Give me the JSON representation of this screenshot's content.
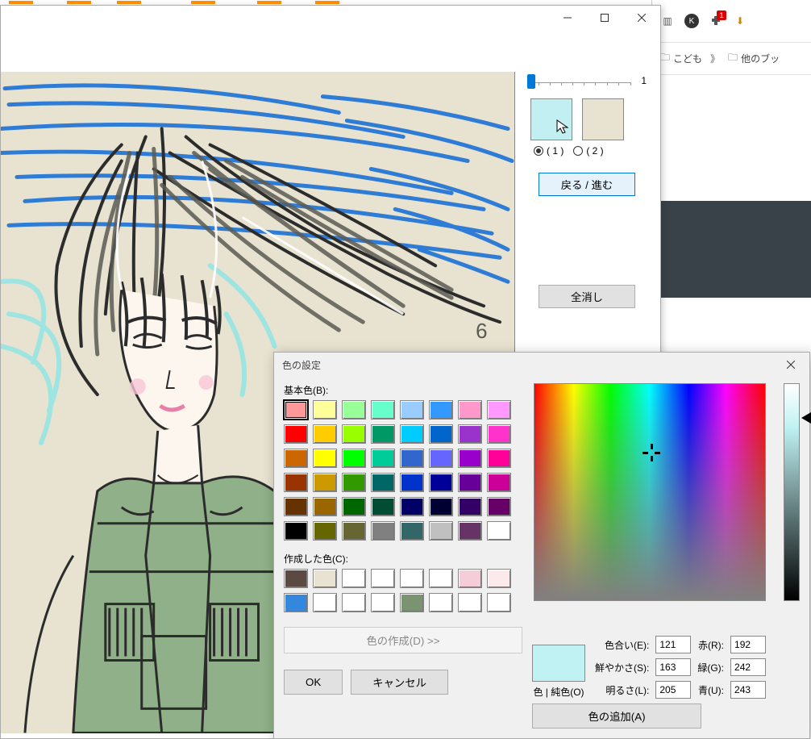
{
  "browser": {
    "bookmark1": "こども",
    "bookmark2": "他のブッ",
    "more": "》",
    "badge": "1"
  },
  "paint": {
    "slider_value": "1",
    "swatch1_color": "#c2f0f2",
    "swatch2_color": "#e8e2d0",
    "radio1_label": "( 1 )",
    "radio2_label": "( 2 )",
    "undo_redo": "戻る / 進む",
    "clear_all": "全消し"
  },
  "color_dialog": {
    "title": "色の設定",
    "basic_label": "基本色(B):",
    "custom_label": "作成した色(C):",
    "expand": "色の作成(D) >>",
    "ok": "OK",
    "cancel": "キャンセル",
    "preview_color": "#c0f2f3",
    "preview_label": "色 | 純色(O)",
    "hue_label": "色合い(E):",
    "hue_value": "121",
    "sat_label": "鮮やかさ(S):",
    "sat_value": "163",
    "lum_label": "明るさ(L):",
    "lum_value": "205",
    "red_label": "赤(R):",
    "red_value": "192",
    "green_label": "緑(G):",
    "green_value": "242",
    "blue_label": "青(U):",
    "blue_value": "243",
    "add_color": "色の追加(A)",
    "basic_colors": [
      "#ff9999",
      "#ffff99",
      "#99ff99",
      "#66ffcc",
      "#99ccff",
      "#3399ff",
      "#ff99cc",
      "#ff99ff",
      "#ff0000",
      "#ffcc00",
      "#99ff00",
      "#009966",
      "#00ccff",
      "#0066cc",
      "#9933cc",
      "#ff33cc",
      "#cc6600",
      "#ffff00",
      "#00ff00",
      "#00cc99",
      "#3366cc",
      "#6666ff",
      "#9900cc",
      "#ff0099",
      "#993300",
      "#cc9900",
      "#339900",
      "#006666",
      "#0033cc",
      "#000099",
      "#660099",
      "#cc0099",
      "#663300",
      "#996600",
      "#006600",
      "#004d33",
      "#000066",
      "#000033",
      "#330066",
      "#660066",
      "#000000",
      "#666600",
      "#666633",
      "#808080",
      "#336666",
      "#c0c0c0",
      "#663366",
      "#ffffff"
    ],
    "custom_colors": [
      "#5a4a42",
      "#e8e2d0",
      "#ffffff",
      "#ffffff",
      "#ffffff",
      "#ffffff",
      "#f5cdd9",
      "#fbe9ec",
      "#3388dd",
      "#ffffff",
      "#ffffff",
      "#ffffff",
      "#7a9370",
      "#ffffff",
      "#ffffff",
      "#ffffff"
    ]
  }
}
